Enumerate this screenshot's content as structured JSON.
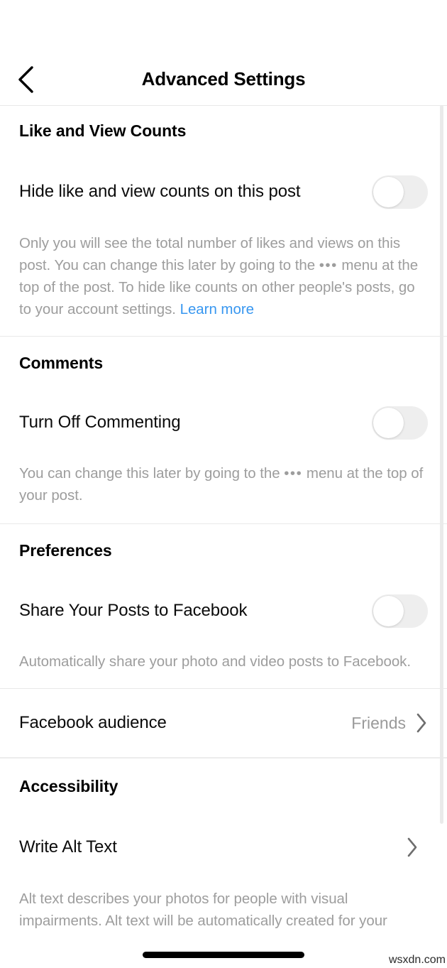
{
  "header": {
    "title": "Advanced Settings",
    "back_icon": "chevron-left-icon"
  },
  "sections": [
    {
      "id": "like-and-view-counts",
      "title": "Like and View Counts",
      "row_label": "Hide like and view counts on this post",
      "toggle_state": "off",
      "description_pre": "Only you will see the total number of likes and views on this post. You can change this later by going to the ",
      "description_dots": "•••",
      "description_mid": " menu at the top of the post. To hide like counts on other people's posts, go to your account settings. ",
      "description_link": "Learn more"
    },
    {
      "id": "comments",
      "title": "Comments",
      "row_label": "Turn Off Commenting",
      "toggle_state": "off",
      "description_pre": "You can change this later by going to the ",
      "description_dots": "•••",
      "description_mid": " menu at the top of your post."
    },
    {
      "id": "preferences",
      "title": "Preferences",
      "row_label": "Share Your Posts to Facebook",
      "toggle_state": "off",
      "description": "Automatically share your photo and video posts to Facebook.",
      "audience_row_label": "Facebook audience",
      "audience_row_value": "Friends",
      "audience_chevron_icon": "chevron-right-icon"
    },
    {
      "id": "accessibility",
      "title": "Accessibility",
      "row_label": "Write Alt Text",
      "chevron_icon": "chevron-right-icon",
      "description": "Alt text describes your photos for people with visual impairments. Alt text will be automatically created for your"
    }
  ],
  "colors": {
    "link": "#3897f0",
    "muted_text": "#9d9d9d",
    "toggle_track_off": "#eeeeee",
    "toggle_knob": "#ffffff",
    "divider": "#e9e9e9",
    "text": "#000000"
  },
  "watermark": "wsxdn.com"
}
